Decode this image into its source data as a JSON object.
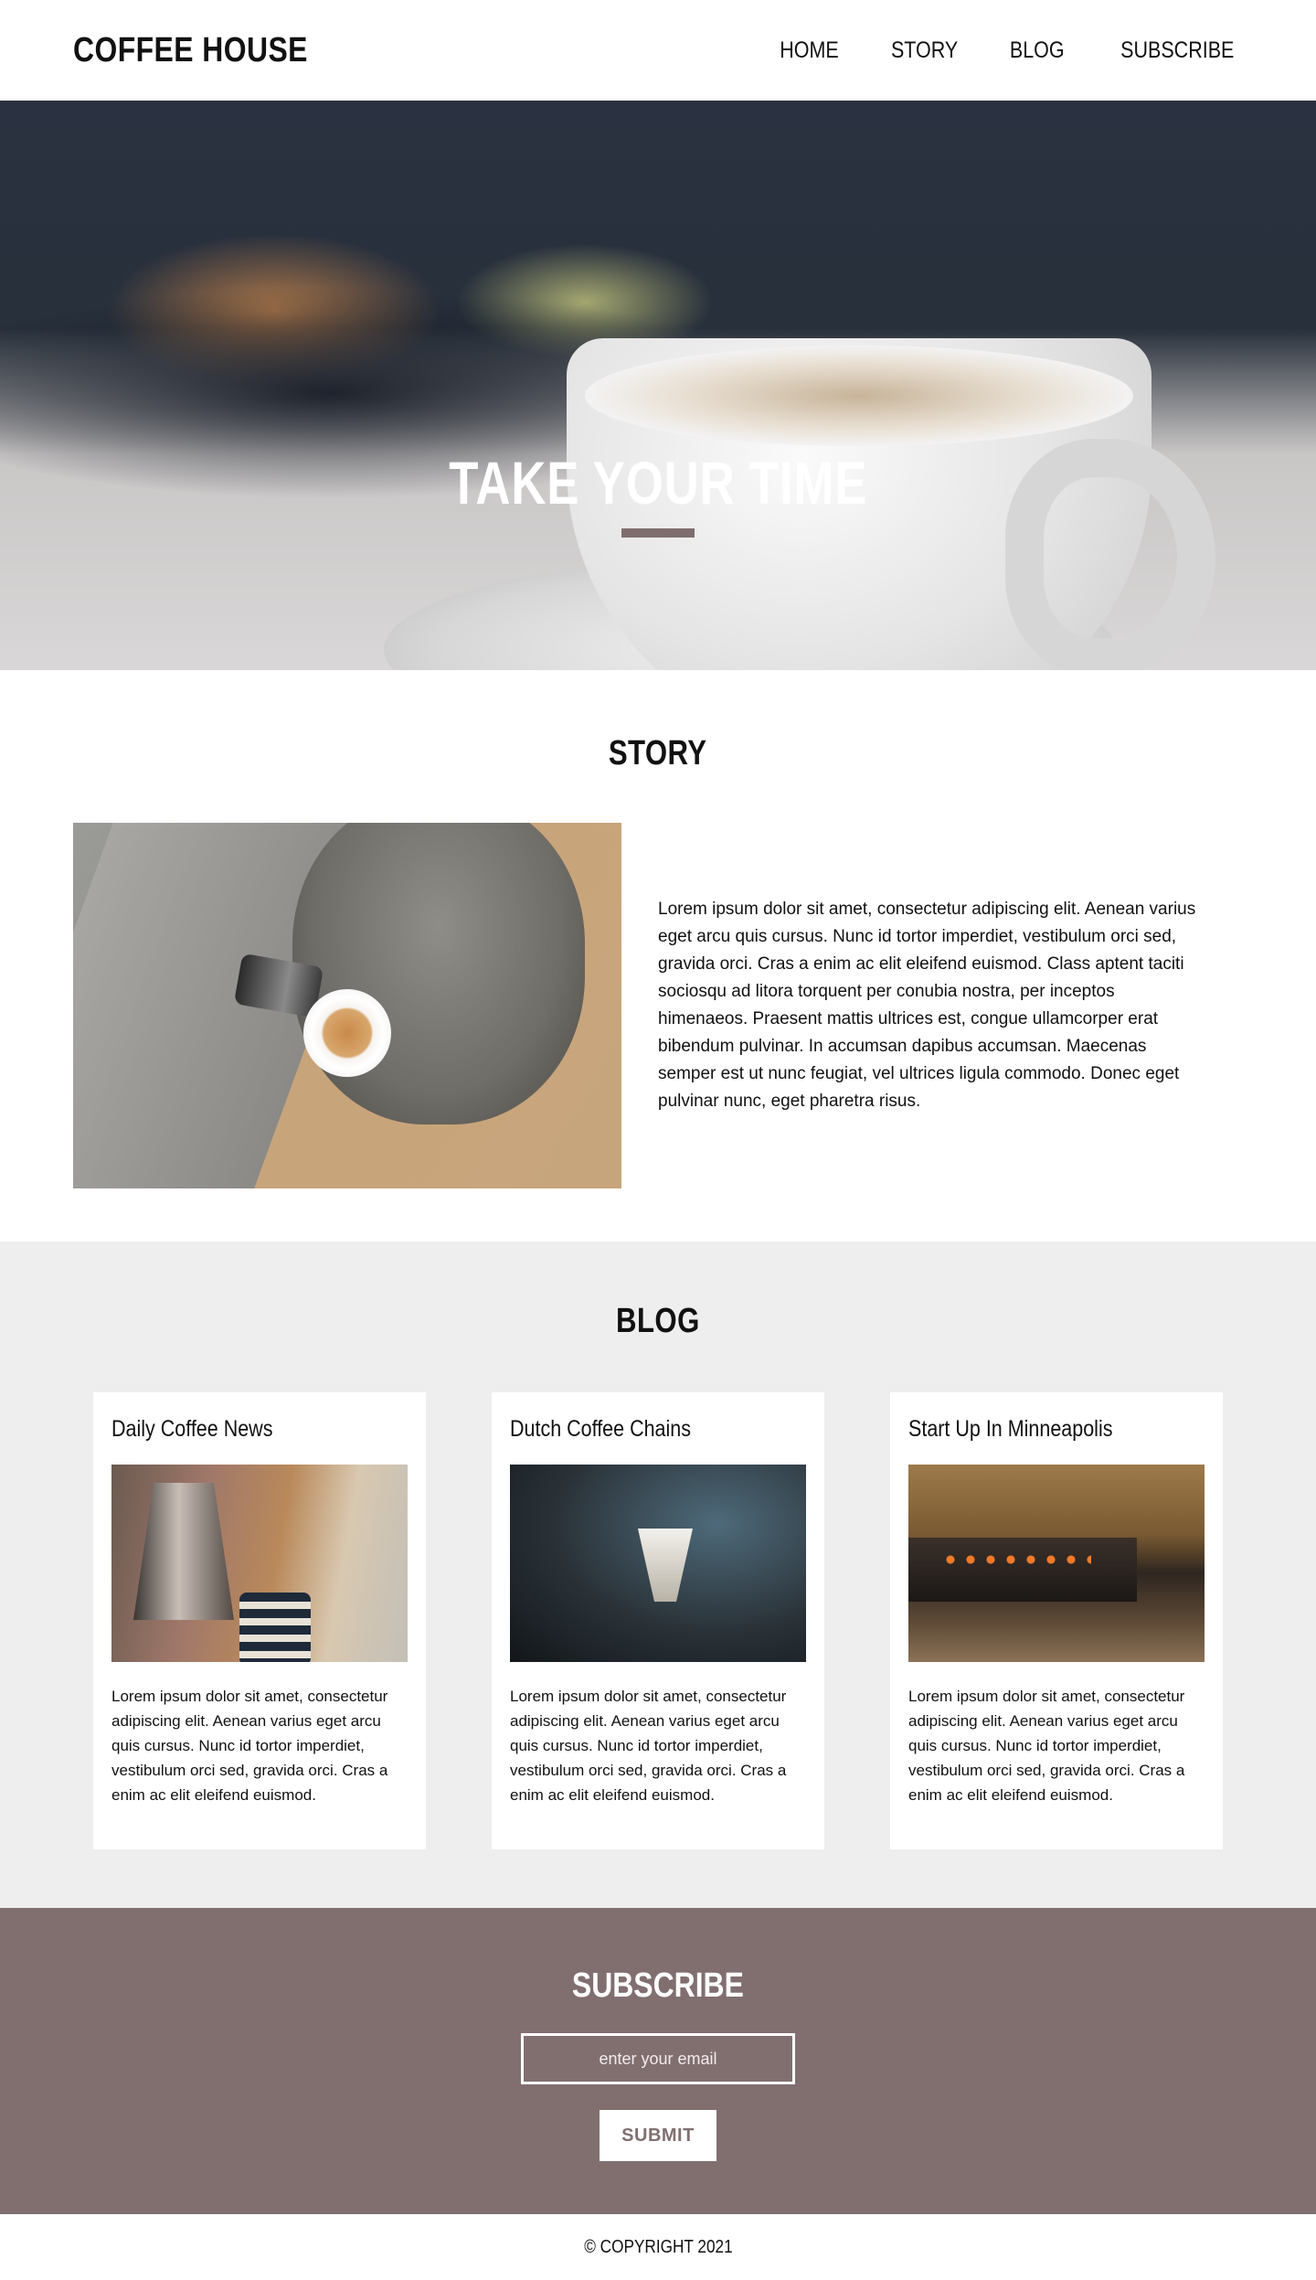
{
  "header": {
    "logo": "COFFEE HOUSE",
    "nav": [
      {
        "label": "HOME"
      },
      {
        "label": "STORY"
      },
      {
        "label": "BLOG"
      },
      {
        "label": "SUBSCRIBE"
      }
    ]
  },
  "hero": {
    "title": "TAKE YOUR TIME",
    "accent_color": "#806e6e"
  },
  "story": {
    "title": "STORY",
    "text": "Lorem ipsum dolor sit amet, consectetur adipiscing elit. Aenean varius eget arcu quis cursus. Nunc id tortor imperdiet, vestibulum orci sed, gravida orci. Cras a enim ac elit eleifend euismod. Class aptent taciti sociosqu ad litora torquent per conubia nostra, per inceptos himenaeos. Praesent mattis ultrices est, congue ullamcorper erat bibendum pulvinar. In accumsan dapibus accumsan. Maecenas semper est ut nunc feugiat, vel ultrices ligula commodo. Donec eget pulvinar nunc, eget pharetra risus."
  },
  "blog": {
    "title": "BLOG",
    "background": "#eeeeee",
    "cards": [
      {
        "title": "Daily Coffee News",
        "text": "Lorem ipsum dolor sit amet, consectetur adipiscing elit. Aenean varius eget arcu quis cursus. Nunc id tortor imperdiet, vestibulum orci sed, gravida orci. Cras a enim ac elit eleifend euismod."
      },
      {
        "title": "Dutch Coffee Chains",
        "text": "Lorem ipsum dolor sit amet, consectetur adipiscing elit. Aenean varius eget arcu quis cursus. Nunc id tortor imperdiet, vestibulum orci sed, gravida orci. Cras a enim ac elit eleifend euismod."
      },
      {
        "title": "Start Up In Minneapolis",
        "text": "Lorem ipsum dolor sit amet, consectetur adipiscing elit. Aenean varius eget arcu quis cursus. Nunc id tortor imperdiet, vestibulum orci sed, gravida orci. Cras a enim ac elit eleifend euismod."
      }
    ]
  },
  "subscribe": {
    "title": "SUBSCRIBE",
    "email_placeholder": "enter your email",
    "submit_label": "SUBMIT",
    "background": "#816f6f"
  },
  "footer": {
    "copyright": "© COPYRIGHT 2021"
  }
}
